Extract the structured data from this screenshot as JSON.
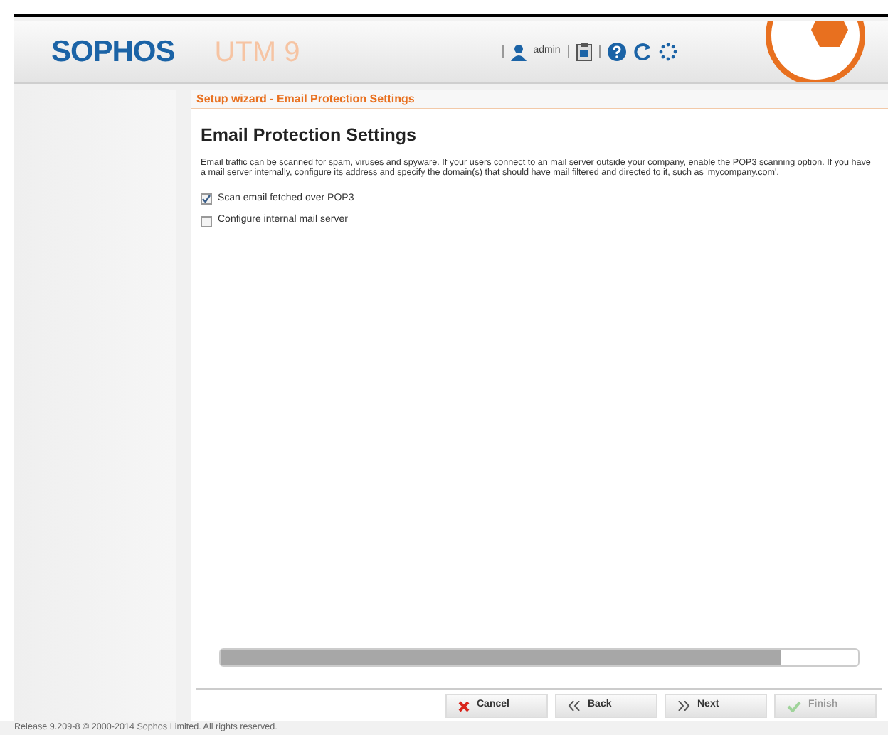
{
  "header": {
    "brand": "SOPHOS",
    "product": "UTM 9",
    "user": "admin"
  },
  "wizard": {
    "title": "Setup wizard - Email Protection Settings",
    "heading": "Email Protection Settings",
    "description": "Email traffic can be scanned for spam, viruses and spyware. If your users connect to an mail server outside your company, enable the POP3 scanning option. If you have a mail server internally, configure its address and specify the domain(s) that should have mail filtered and directed to it, such as 'mycompany.com'.",
    "options": [
      {
        "label": "Scan email fetched over POP3",
        "checked": true
      },
      {
        "label": "Configure internal mail server",
        "checked": false
      }
    ],
    "progress": {
      "level": 0.88
    },
    "buttons": [
      {
        "label": "Cancel",
        "kind": "cancel",
        "disabled": false
      },
      {
        "label": "Back",
        "kind": "back",
        "disabled": false
      },
      {
        "label": "Next",
        "kind": "next",
        "disabled": false
      },
      {
        "label": "Finish",
        "kind": "finish",
        "disabled": true
      }
    ]
  },
  "status_bar": "Release 9.209-8 © 2000-2014 Sophos Limited. All rights reserved."
}
